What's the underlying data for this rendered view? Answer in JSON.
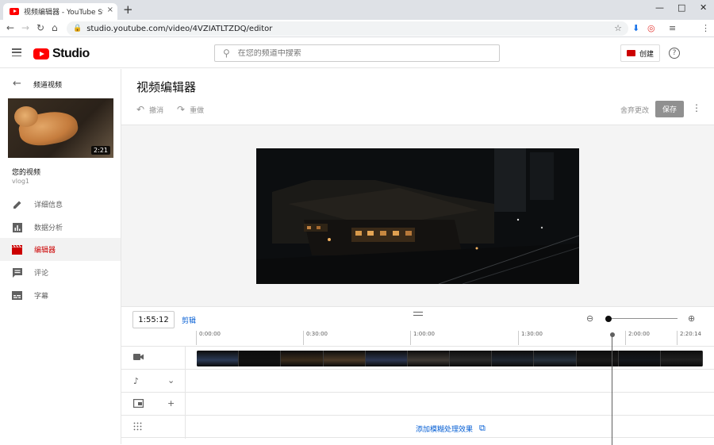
{
  "browser": {
    "tab_title": "视频编辑器 - YouTube Studio",
    "tab_close": "×",
    "new_tab": "+",
    "minimize": "—",
    "maximize": "□",
    "close": "✕",
    "url": "studio.youtube.com/video/4VZIATLTZDQ/editor",
    "back": "←",
    "forward": "→",
    "reload": "↻",
    "home": "⌂"
  },
  "header": {
    "logo_text": "Studio",
    "search_placeholder": "在您的频道中搜索",
    "create_label": "创建",
    "help": "?"
  },
  "sidebar": {
    "back_label": "频道视频",
    "thumbnail_duration": "2:21",
    "section_title": "您的视频",
    "video_name": "vlog1",
    "items": [
      {
        "label": "详细信息",
        "icon": "pencil-icon"
      },
      {
        "label": "数据分析",
        "icon": "analytics-icon"
      },
      {
        "label": "编辑器",
        "icon": "clapperboard-icon",
        "active": true
      },
      {
        "label": "评论",
        "icon": "comment-icon"
      },
      {
        "label": "字幕",
        "icon": "subtitles-icon"
      }
    ]
  },
  "main": {
    "title": "视频编辑器",
    "undo_label": "撤消",
    "redo_label": "重做",
    "discard_label": "舍弃更改",
    "save_label": "保存",
    "more": "⋮"
  },
  "timeline": {
    "current_time": "1:55:12",
    "trim_label": "剪辑",
    "ruler_labels": [
      "0:00:00",
      "0:30:00",
      "1:00:00",
      "1:30:00",
      "2:00:00",
      "2:20:14"
    ],
    "blur_label": "添加模糊处理效果",
    "tracks": [
      "video",
      "audio",
      "end-screen",
      "blur"
    ],
    "frame_count": 12,
    "playhead_fraction": 0.82,
    "zoom_level": 0.0
  },
  "colors": {
    "brand_red": "#ff0000",
    "active_red": "#cc0000",
    "link_blue": "#065fd4"
  }
}
